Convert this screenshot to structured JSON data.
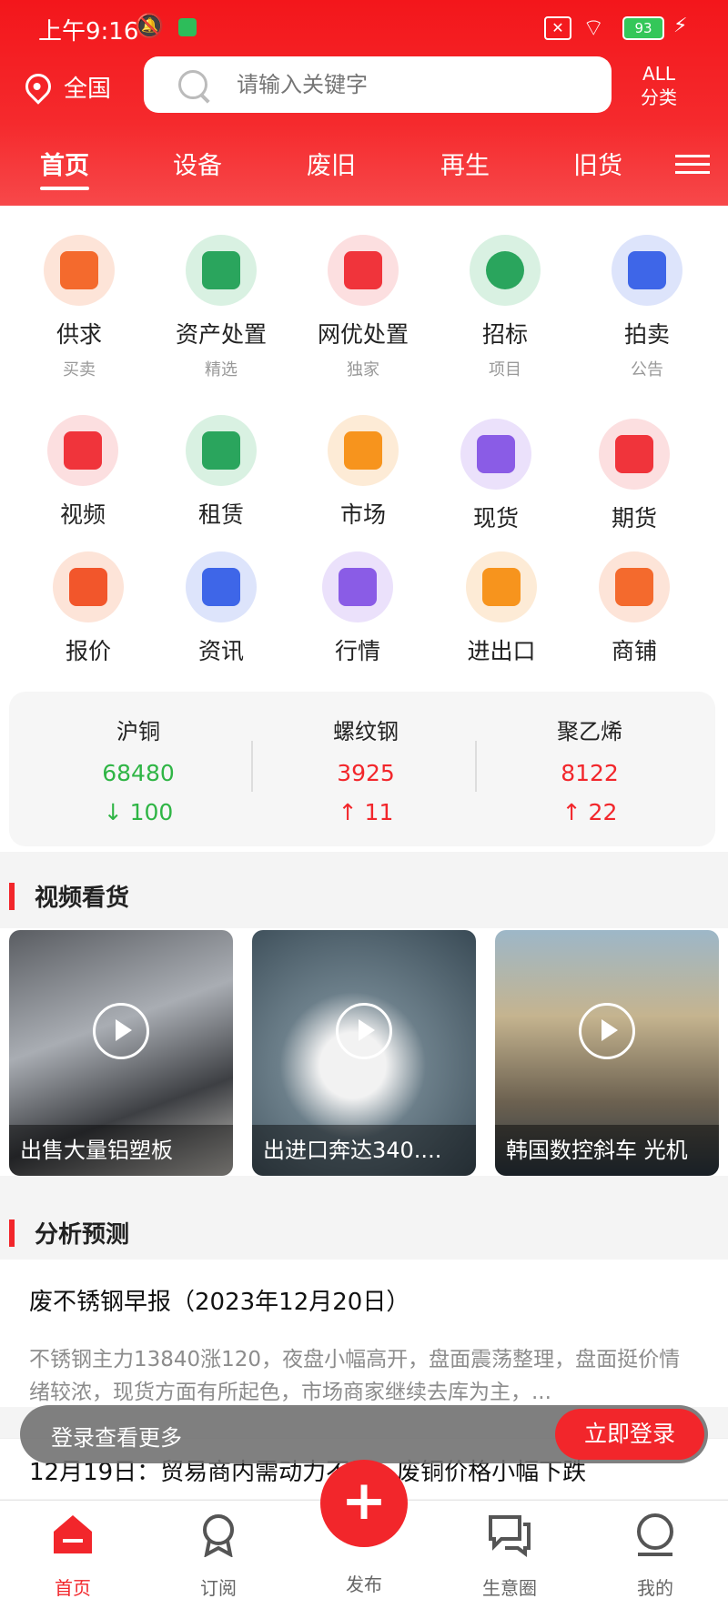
{
  "status_bar": {
    "time": "上午9:16",
    "battery": "93"
  },
  "header": {
    "location": "全国",
    "search_placeholder": "请输入关键字",
    "all_line1": "ALL",
    "all_line2": "分类",
    "tabs": [
      "首页",
      "设备",
      "废旧",
      "再生",
      "旧货"
    ]
  },
  "grid": [
    {
      "label": "供求",
      "sub": "买卖",
      "color": "#f46a2d",
      "icon": "bag-icon"
    },
    {
      "label": "资产处置",
      "sub": "精选",
      "color": "#2aa55d",
      "icon": "building-icon"
    },
    {
      "label": "网优处置",
      "sub": "独家",
      "color": "#f0343b",
      "icon": "hand-doc-icon"
    },
    {
      "label": "招标",
      "sub": "项目",
      "color": "#2aa55d",
      "icon": "target-icon"
    },
    {
      "label": "拍卖",
      "sub": "公告",
      "color": "#3e66e8",
      "icon": "gavel-icon"
    },
    {
      "label": "视频",
      "sub": "",
      "color": "#f0343b",
      "icon": "video-icon"
    },
    {
      "label": "租赁",
      "sub": "",
      "color": "#2aa55d",
      "icon": "tools-icon"
    },
    {
      "label": "市场",
      "sub": "",
      "color": "#f7941d",
      "icon": "market-icon"
    },
    {
      "label": "现货",
      "sub": "",
      "color": "#8a5ce6",
      "icon": "goods-icon"
    },
    {
      "label": "期货",
      "sub": "",
      "color": "#f0343b",
      "icon": "warehouse-icon"
    },
    {
      "label": "报价",
      "sub": "",
      "color": "#f2562b",
      "icon": "quote-icon"
    },
    {
      "label": "资讯",
      "sub": "",
      "color": "#3e66e8",
      "icon": "news-icon"
    },
    {
      "label": "行情",
      "sub": "",
      "color": "#8a5ce6",
      "icon": "trend-icon"
    },
    {
      "label": "进出口",
      "sub": "",
      "color": "#f7941d",
      "icon": "exchange-icon"
    },
    {
      "label": "商铺",
      "sub": "",
      "color": "#f46a2d",
      "icon": "shop-icon"
    }
  ],
  "prices": [
    {
      "name": "沪铜",
      "value": "68480",
      "change": "↓ 100",
      "color": "#2fb545"
    },
    {
      "name": "螺纹钢",
      "value": "3925",
      "change": "↑ 11",
      "color": "#f2262b"
    },
    {
      "name": "聚乙烯",
      "value": "8122",
      "change": "↑ 22",
      "color": "#f2262b"
    }
  ],
  "sections": {
    "videos": "视频看货",
    "analysis": "分析预测"
  },
  "videos": [
    {
      "caption": "出售大量铝塑板"
    },
    {
      "caption": "出进口奔达340...."
    },
    {
      "caption": "韩国数控斜车 光机"
    }
  ],
  "articles": [
    {
      "title": "废不锈钢早报（2023年12月20日）",
      "body": "不锈钢主力13840涨120，夜盘小幅高开，盘面震荡整理，盘面挺价情绪较浓，现货方面有所起色，市场商家继续去库为主，..."
    },
    {
      "title": "12月19日：贸易商内需动力不足，废铜价格小幅下跌",
      "body": ""
    }
  ],
  "login": {
    "text": "登录查看更多",
    "button": "立即登录"
  },
  "nav": [
    {
      "label": "首页",
      "icon": "home-icon"
    },
    {
      "label": "订阅",
      "icon": "medal-icon"
    },
    {
      "label": "发布",
      "icon": "plus-icon"
    },
    {
      "label": "生意圈",
      "icon": "chat-icon"
    },
    {
      "label": "我的",
      "icon": "user-icon"
    }
  ]
}
